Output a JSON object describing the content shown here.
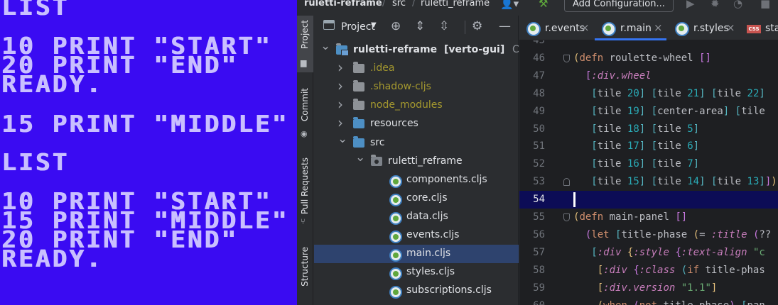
{
  "c64": {
    "lines": [
      "LIST",
      "10 PRINT \"START\"",
      "20 PRINT \"END\"",
      "READY.",
      "15 PRINT \"MIDDLE\"",
      "LIST",
      "10 PRINT \"START\"",
      "15 PRINT \"MIDDLE\"",
      "20 PRINT \"END\"",
      "READY."
    ]
  },
  "titlebar": {
    "project": "ruletti-reframe",
    "crumb_src": "src",
    "crumb_pkg": "ruletti_reframe",
    "add_config": "Add Configuration..."
  },
  "strip": {
    "project": "Project",
    "commit": "Commit",
    "pull_requests": "Pull Requests",
    "structure": "Structure"
  },
  "project_panel": {
    "title": "Project",
    "tree": [
      {
        "label": "ruletti-reframe",
        "extra": "[verto-gui]",
        "path": "C:\\githu",
        "depth": 0,
        "kind": "root",
        "expanded": true
      },
      {
        "label": ".idea",
        "depth": 1,
        "kind": "folder",
        "style": "ignored"
      },
      {
        "label": ".shadow-cljs",
        "depth": 1,
        "kind": "folder",
        "style": "ignored"
      },
      {
        "label": "node_modules",
        "depth": 1,
        "kind": "folder",
        "style": "ignored"
      },
      {
        "label": "resources",
        "depth": 1,
        "kind": "folder-blue"
      },
      {
        "label": "src",
        "depth": 1,
        "kind": "folder-blue",
        "expanded": true
      },
      {
        "label": "ruletti_reframe",
        "depth": 2,
        "kind": "package",
        "expanded": true
      },
      {
        "label": "components.cljs",
        "depth": 3,
        "kind": "cljs"
      },
      {
        "label": "core.cljs",
        "depth": 3,
        "kind": "cljs"
      },
      {
        "label": "data.cljs",
        "depth": 3,
        "kind": "cljs"
      },
      {
        "label": "events.cljs",
        "depth": 3,
        "kind": "cljs"
      },
      {
        "label": "main.cljs",
        "depth": 3,
        "kind": "cljs",
        "selected": true
      },
      {
        "label": "styles.cljs",
        "depth": 3,
        "kind": "cljs"
      },
      {
        "label": "subscriptions.cljs",
        "depth": 3,
        "kind": "cljs"
      }
    ]
  },
  "tabs": [
    {
      "label": "r.events",
      "icon": "cljs",
      "active": false
    },
    {
      "label": "r.main",
      "icon": "cljs",
      "active": true
    },
    {
      "label": "r.styles",
      "icon": "cljs",
      "active": false
    },
    {
      "label": "stat",
      "icon": "css",
      "active": false
    }
  ],
  "editor": {
    "current_line": 54,
    "lines": [
      {
        "n": "45",
        "tokens": []
      },
      {
        "n": "46",
        "tokens": [
          [
            "p1",
            "("
          ],
          [
            "kw",
            "defn"
          ],
          [
            "fn",
            " roulette-wheel "
          ],
          [
            "p2",
            "[]"
          ]
        ]
      },
      {
        "n": "47",
        "tokens": [
          [
            "fn",
            "  "
          ],
          [
            "p2",
            "["
          ],
          [
            "kwd",
            ":div.wheel"
          ]
        ]
      },
      {
        "n": "48",
        "tokens": [
          [
            "fn",
            "   "
          ],
          [
            "p3",
            "["
          ],
          [
            "fn",
            "tile "
          ],
          [
            "num",
            "20"
          ],
          [
            "p3",
            "]"
          ],
          [
            "fn",
            " "
          ],
          [
            "p3",
            "["
          ],
          [
            "fn",
            "tile "
          ],
          [
            "num",
            "21"
          ],
          [
            "p3",
            "]"
          ],
          [
            "fn",
            " "
          ],
          [
            "p3",
            "["
          ],
          [
            "fn",
            "tile "
          ],
          [
            "num",
            "22"
          ],
          [
            "p3",
            "]"
          ]
        ]
      },
      {
        "n": "49",
        "tokens": [
          [
            "fn",
            "   "
          ],
          [
            "p3",
            "["
          ],
          [
            "fn",
            "tile "
          ],
          [
            "num",
            "19"
          ],
          [
            "p3",
            "]"
          ],
          [
            "fn",
            " "
          ],
          [
            "p3",
            "["
          ],
          [
            "fn",
            "center-area"
          ],
          [
            "p3",
            "]"
          ],
          [
            "fn",
            " "
          ],
          [
            "p3",
            "["
          ],
          [
            "fn",
            "tile"
          ]
        ]
      },
      {
        "n": "50",
        "tokens": [
          [
            "fn",
            "   "
          ],
          [
            "p3",
            "["
          ],
          [
            "fn",
            "tile "
          ],
          [
            "num",
            "18"
          ],
          [
            "p3",
            "]"
          ],
          [
            "fn",
            " "
          ],
          [
            "p3",
            "["
          ],
          [
            "fn",
            "tile "
          ],
          [
            "num",
            "5"
          ],
          [
            "p3",
            "]"
          ]
        ]
      },
      {
        "n": "51",
        "tokens": [
          [
            "fn",
            "   "
          ],
          [
            "p3",
            "["
          ],
          [
            "fn",
            "tile "
          ],
          [
            "num",
            "17"
          ],
          [
            "p3",
            "]"
          ],
          [
            "fn",
            " "
          ],
          [
            "p3",
            "["
          ],
          [
            "fn",
            "tile "
          ],
          [
            "num",
            "6"
          ],
          [
            "p3",
            "]"
          ]
        ]
      },
      {
        "n": "52",
        "tokens": [
          [
            "fn",
            "   "
          ],
          [
            "p3",
            "["
          ],
          [
            "fn",
            "tile "
          ],
          [
            "num",
            "16"
          ],
          [
            "p3",
            "]"
          ],
          [
            "fn",
            " "
          ],
          [
            "p3",
            "["
          ],
          [
            "fn",
            "tile "
          ],
          [
            "num",
            "7"
          ],
          [
            "p3",
            "]"
          ]
        ]
      },
      {
        "n": "53",
        "tokens": [
          [
            "fn",
            "   "
          ],
          [
            "p3",
            "["
          ],
          [
            "fn",
            "tile "
          ],
          [
            "num",
            "15"
          ],
          [
            "p3",
            "]"
          ],
          [
            "fn",
            " "
          ],
          [
            "p3",
            "["
          ],
          [
            "fn",
            "tile "
          ],
          [
            "num",
            "14"
          ],
          [
            "p3",
            "]"
          ],
          [
            "fn",
            " "
          ],
          [
            "p3",
            "["
          ],
          [
            "fn",
            "tile "
          ],
          [
            "num",
            "13"
          ],
          [
            "p3",
            "]"
          ],
          [
            "p2",
            "]"
          ],
          [
            "p1",
            ")"
          ]
        ]
      },
      {
        "n": "54",
        "tokens": []
      },
      {
        "n": "55",
        "tokens": [
          [
            "p1",
            "("
          ],
          [
            "kw",
            "defn"
          ],
          [
            "fn",
            " main-panel "
          ],
          [
            "p2",
            "[]"
          ]
        ]
      },
      {
        "n": "56",
        "tokens": [
          [
            "fn",
            "  "
          ],
          [
            "p2",
            "("
          ],
          [
            "kw",
            "let"
          ],
          [
            "fn",
            " "
          ],
          [
            "p3",
            "["
          ],
          [
            "fn",
            "title-phase "
          ],
          [
            "p1",
            "("
          ],
          [
            "fn",
            "= "
          ],
          [
            "kwd",
            ":title"
          ],
          [
            "fn",
            " "
          ],
          [
            "p2",
            "("
          ],
          [
            "fn",
            "??"
          ]
        ]
      },
      {
        "n": "57",
        "tokens": [
          [
            "fn",
            "   "
          ],
          [
            "p3",
            "["
          ],
          [
            "kwd",
            ":div"
          ],
          [
            "fn",
            " "
          ],
          [
            "p1",
            "{"
          ],
          [
            "kwd",
            ":style"
          ],
          [
            "fn",
            " "
          ],
          [
            "p2",
            "{"
          ],
          [
            "kwd",
            ":text-align"
          ],
          [
            "fn",
            " "
          ],
          [
            "str",
            "\"c"
          ]
        ]
      },
      {
        "n": "58",
        "tokens": [
          [
            "fn",
            "    "
          ],
          [
            "p1",
            "["
          ],
          [
            "kwd",
            ":div"
          ],
          [
            "fn",
            " "
          ],
          [
            "p2",
            "{"
          ],
          [
            "kwd",
            ":class"
          ],
          [
            "fn",
            " "
          ],
          [
            "p3",
            "("
          ],
          [
            "kw",
            "if"
          ],
          [
            "fn",
            " title-phas"
          ]
        ]
      },
      {
        "n": "59",
        "tokens": [
          [
            "fn",
            "    "
          ],
          [
            "p1",
            "["
          ],
          [
            "kwd",
            ":div.version"
          ],
          [
            "fn",
            " "
          ],
          [
            "str",
            "\"1.1\""
          ],
          [
            "p1",
            "]"
          ]
        ]
      },
      {
        "n": "60",
        "tokens": [
          [
            "fn",
            "    "
          ],
          [
            "p1",
            "("
          ],
          [
            "kw",
            "when"
          ],
          [
            "fn",
            " "
          ],
          [
            "p2",
            "("
          ],
          [
            "kw",
            "not"
          ],
          [
            "fn",
            " title-phase"
          ],
          [
            "p2",
            ")"
          ],
          [
            "fn",
            " "
          ],
          [
            "p3",
            "["
          ],
          [
            "fn",
            "pan"
          ]
        ]
      }
    ]
  }
}
